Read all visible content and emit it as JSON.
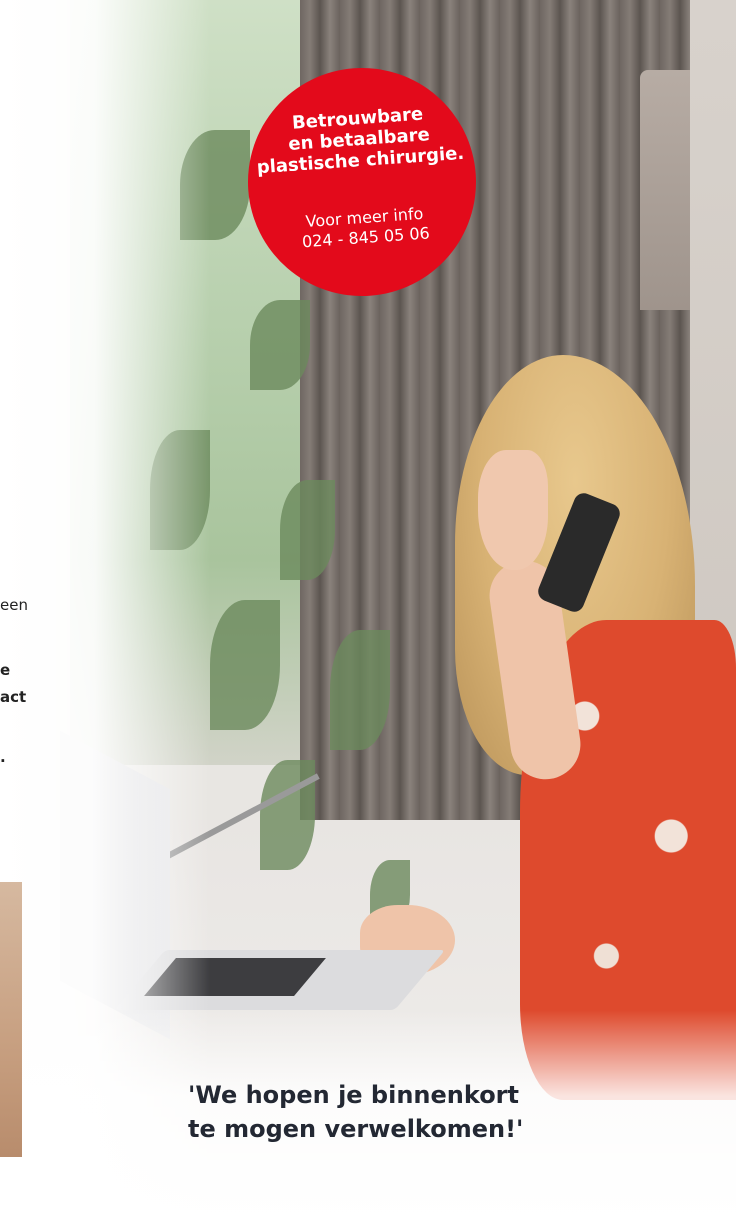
{
  "badge": {
    "headline": [
      "Betrouwbare",
      "en betaalbare",
      "plastische chirurgie."
    ],
    "info_label": "Voor meer info",
    "phone": "024 - 845 05 06",
    "color": "#e30a1b"
  },
  "left_column_fragments": {
    "line1": "een",
    "line2": "e",
    "line3": "act",
    "line4": "."
  },
  "quote": {
    "line1": "'We hopen je binnenkort",
    "line2": "te mogen verwelkomen!'"
  }
}
